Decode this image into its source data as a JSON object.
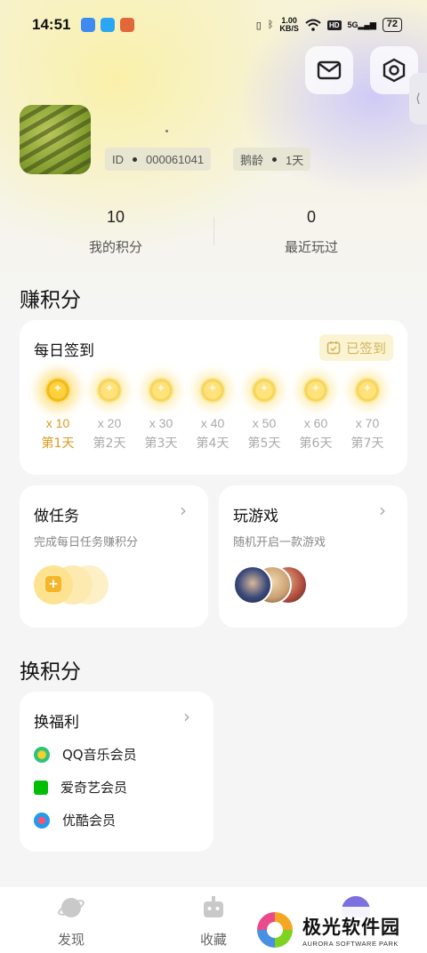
{
  "status_bar": {
    "time": "14:51",
    "speed_value": "1.00",
    "speed_unit": "KB/S",
    "hd": "HD",
    "network": "5G",
    "battery": "72"
  },
  "header": {
    "mail_icon": "mail-icon",
    "settings_icon": "settings-icon",
    "side_tab_glyph": "⟨"
  },
  "profile": {
    "id_label": "ID",
    "id_value": "000061041",
    "age_label": "鹅龄",
    "age_value": "1天"
  },
  "stats": [
    {
      "value": "10",
      "label": "我的积分"
    },
    {
      "value": "0",
      "label": "最近玩过"
    }
  ],
  "earn": {
    "section_title": "赚积分",
    "checkin": {
      "title": "每日签到",
      "status": "已签到",
      "days": [
        {
          "points": "x 10",
          "label": "第1天",
          "active": true
        },
        {
          "points": "x 20",
          "label": "第2天",
          "active": false
        },
        {
          "points": "x 30",
          "label": "第3天",
          "active": false
        },
        {
          "points": "x 40",
          "label": "第4天",
          "active": false
        },
        {
          "points": "x 50",
          "label": "第5天",
          "active": false
        },
        {
          "points": "x 60",
          "label": "第6天",
          "active": false
        },
        {
          "points": "x 70",
          "label": "第7天",
          "active": false
        }
      ]
    },
    "tasks": {
      "title": "做任务",
      "subtitle": "完成每日任务赚积分"
    },
    "play": {
      "title": "玩游戏",
      "subtitle": "随机开启一款游戏"
    }
  },
  "exchange": {
    "section_title": "换积分",
    "welfare": {
      "title": "换福利",
      "items": [
        {
          "label": "QQ音乐会员",
          "icon": "qq-music-icon",
          "color": "#31c27c"
        },
        {
          "label": "爱奇艺会员",
          "icon": "iqiyi-icon",
          "color": "#00be06"
        },
        {
          "label": "优酷会员",
          "icon": "youku-icon",
          "color": "#1f9cf0"
        }
      ]
    }
  },
  "bottom_nav": [
    {
      "label": "发现",
      "icon": "discover-icon"
    },
    {
      "label": "收藏",
      "icon": "robot-icon"
    }
  ],
  "watermark": {
    "cn": "极光软件园",
    "en": "AURORA SOFTWARE PARK"
  },
  "colors": {
    "accent": "#d99a1c",
    "signed_bg": "#fbf4d3"
  }
}
